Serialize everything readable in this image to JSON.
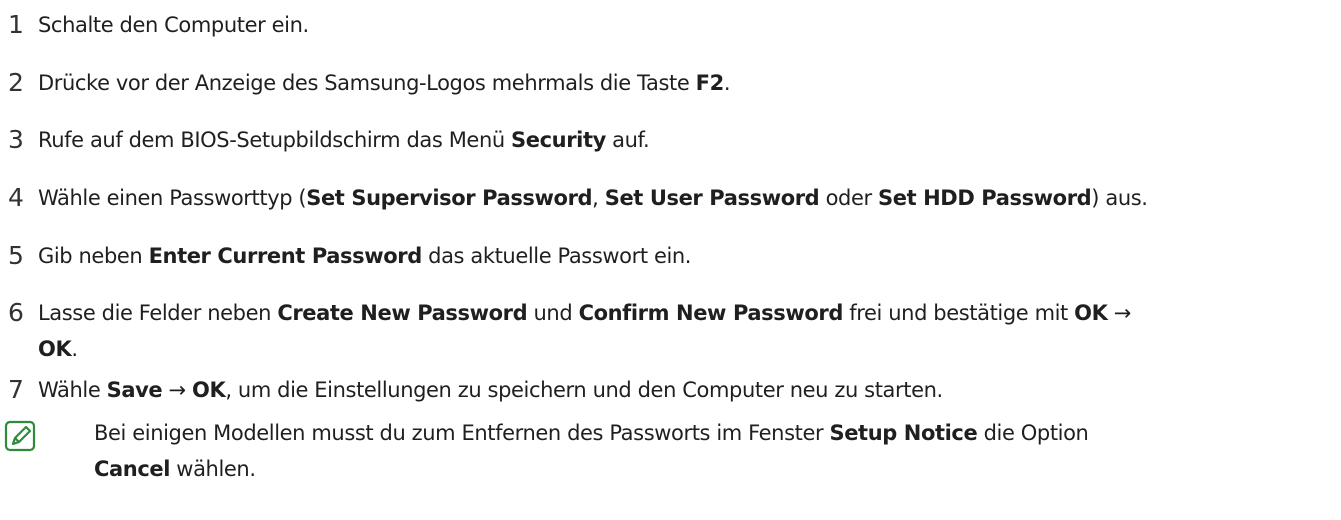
{
  "steps": [
    {
      "number": "1",
      "parts": [
        {
          "t": "Schalte den Computer ein.",
          "b": false
        }
      ]
    },
    {
      "number": "2",
      "parts": [
        {
          "t": "Drücke vor der Anzeige des Samsung-Logos mehrmals die Taste ",
          "b": false
        },
        {
          "t": "F2",
          "b": true
        },
        {
          "t": ".",
          "b": false
        }
      ]
    },
    {
      "number": "3",
      "parts": [
        {
          "t": "Rufe auf dem BIOS-Setupbildschirm das Menü ",
          "b": false
        },
        {
          "t": "Security",
          "b": true
        },
        {
          "t": " auf.",
          "b": false
        }
      ]
    },
    {
      "number": "4",
      "parts": [
        {
          "t": "Wähle einen Passworttyp (",
          "b": false
        },
        {
          "t": "Set Supervisor Password",
          "b": true
        },
        {
          "t": ", ",
          "b": false
        },
        {
          "t": "Set User Password",
          "b": true
        },
        {
          "t": " oder ",
          "b": false
        },
        {
          "t": "Set HDD Password",
          "b": true
        },
        {
          "t": ") aus.",
          "b": false
        }
      ]
    },
    {
      "number": "5",
      "parts": [
        {
          "t": "Gib neben ",
          "b": false
        },
        {
          "t": "Enter Current Password",
          "b": true
        },
        {
          "t": " das aktuelle Passwort ein.",
          "b": false
        }
      ]
    },
    {
      "number": "6",
      "parts": [
        {
          "t": "Lasse die Felder neben ",
          "b": false
        },
        {
          "t": "Create New Password",
          "b": true
        },
        {
          "t": " und ",
          "b": false
        },
        {
          "t": "Confirm New Password",
          "b": true
        },
        {
          "t": " frei und bestätige mit ",
          "b": false
        },
        {
          "t": "OK",
          "b": true
        },
        {
          "t": " →",
          "b": false
        }
      ],
      "continuation": [
        {
          "t": "OK",
          "b": true
        },
        {
          "t": ".",
          "b": false
        }
      ]
    },
    {
      "number": "7",
      "parts": [
        {
          "t": "Wähle ",
          "b": false
        },
        {
          "t": "Save",
          "b": true
        },
        {
          "t": " → ",
          "b": false
        },
        {
          "t": "OK",
          "b": true
        },
        {
          "t": ", um die Einstellungen zu speichern und den Computer neu zu starten.",
          "b": false
        }
      ]
    }
  ],
  "note": {
    "icon": "note-pencil-icon",
    "icon_color": "#2e8b3a",
    "lines": [
      [
        {
          "t": "Bei einigen Modellen musst du zum Entfernen des Passworts im Fenster ",
          "b": false
        },
        {
          "t": "Setup Notice",
          "b": true
        },
        {
          "t": " die Option",
          "b": false
        }
      ],
      [
        {
          "t": "Cancel",
          "b": true
        },
        {
          "t": " wählen.",
          "b": false
        }
      ]
    ]
  }
}
